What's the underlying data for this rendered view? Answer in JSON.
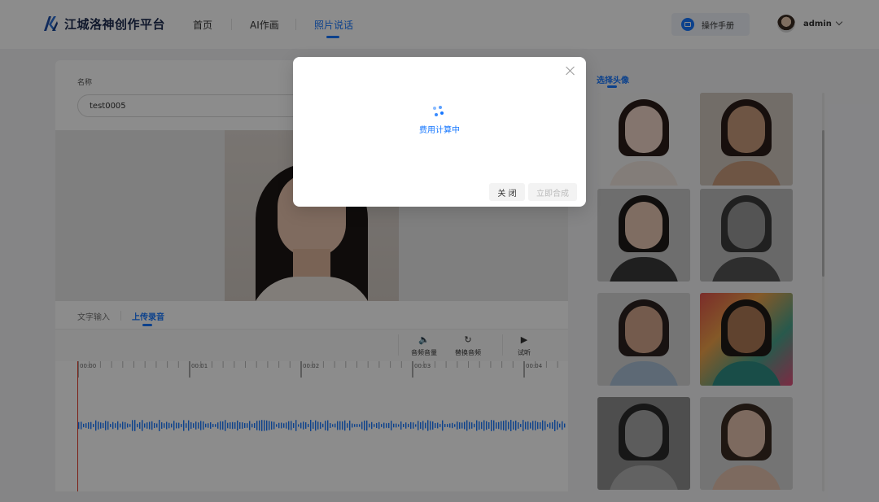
{
  "header": {
    "logo_text": "江城洛神创作平台",
    "nav": [
      {
        "label": "首页",
        "active": false
      },
      {
        "label": "AI作画",
        "active": false
      },
      {
        "label": "照片说话",
        "active": true
      }
    ],
    "manual_label": "操作手册",
    "user_name": "admin"
  },
  "form": {
    "name_label": "名称",
    "name_value": "test0005"
  },
  "tabs": [
    {
      "label": "文字输入",
      "active": false
    },
    {
      "label": "上传录音",
      "active": true
    }
  ],
  "audio_tools": [
    {
      "label": "音频音量",
      "icon": "volume-icon"
    },
    {
      "label": "替换音频",
      "icon": "replace-icon"
    },
    {
      "label": "试听",
      "icon": "play-icon"
    }
  ],
  "timeline": {
    "ticks": [
      "00:00",
      "00:01",
      "00:02",
      "00:03",
      "00:04"
    ]
  },
  "right_panel": {
    "title": "选择头像"
  },
  "modal": {
    "status_text": "费用计算中",
    "close_button": "关 闭",
    "synthesize_button": "立即合成"
  },
  "colors": {
    "accent": "#1677ff",
    "playhead": "#e23c2a"
  }
}
